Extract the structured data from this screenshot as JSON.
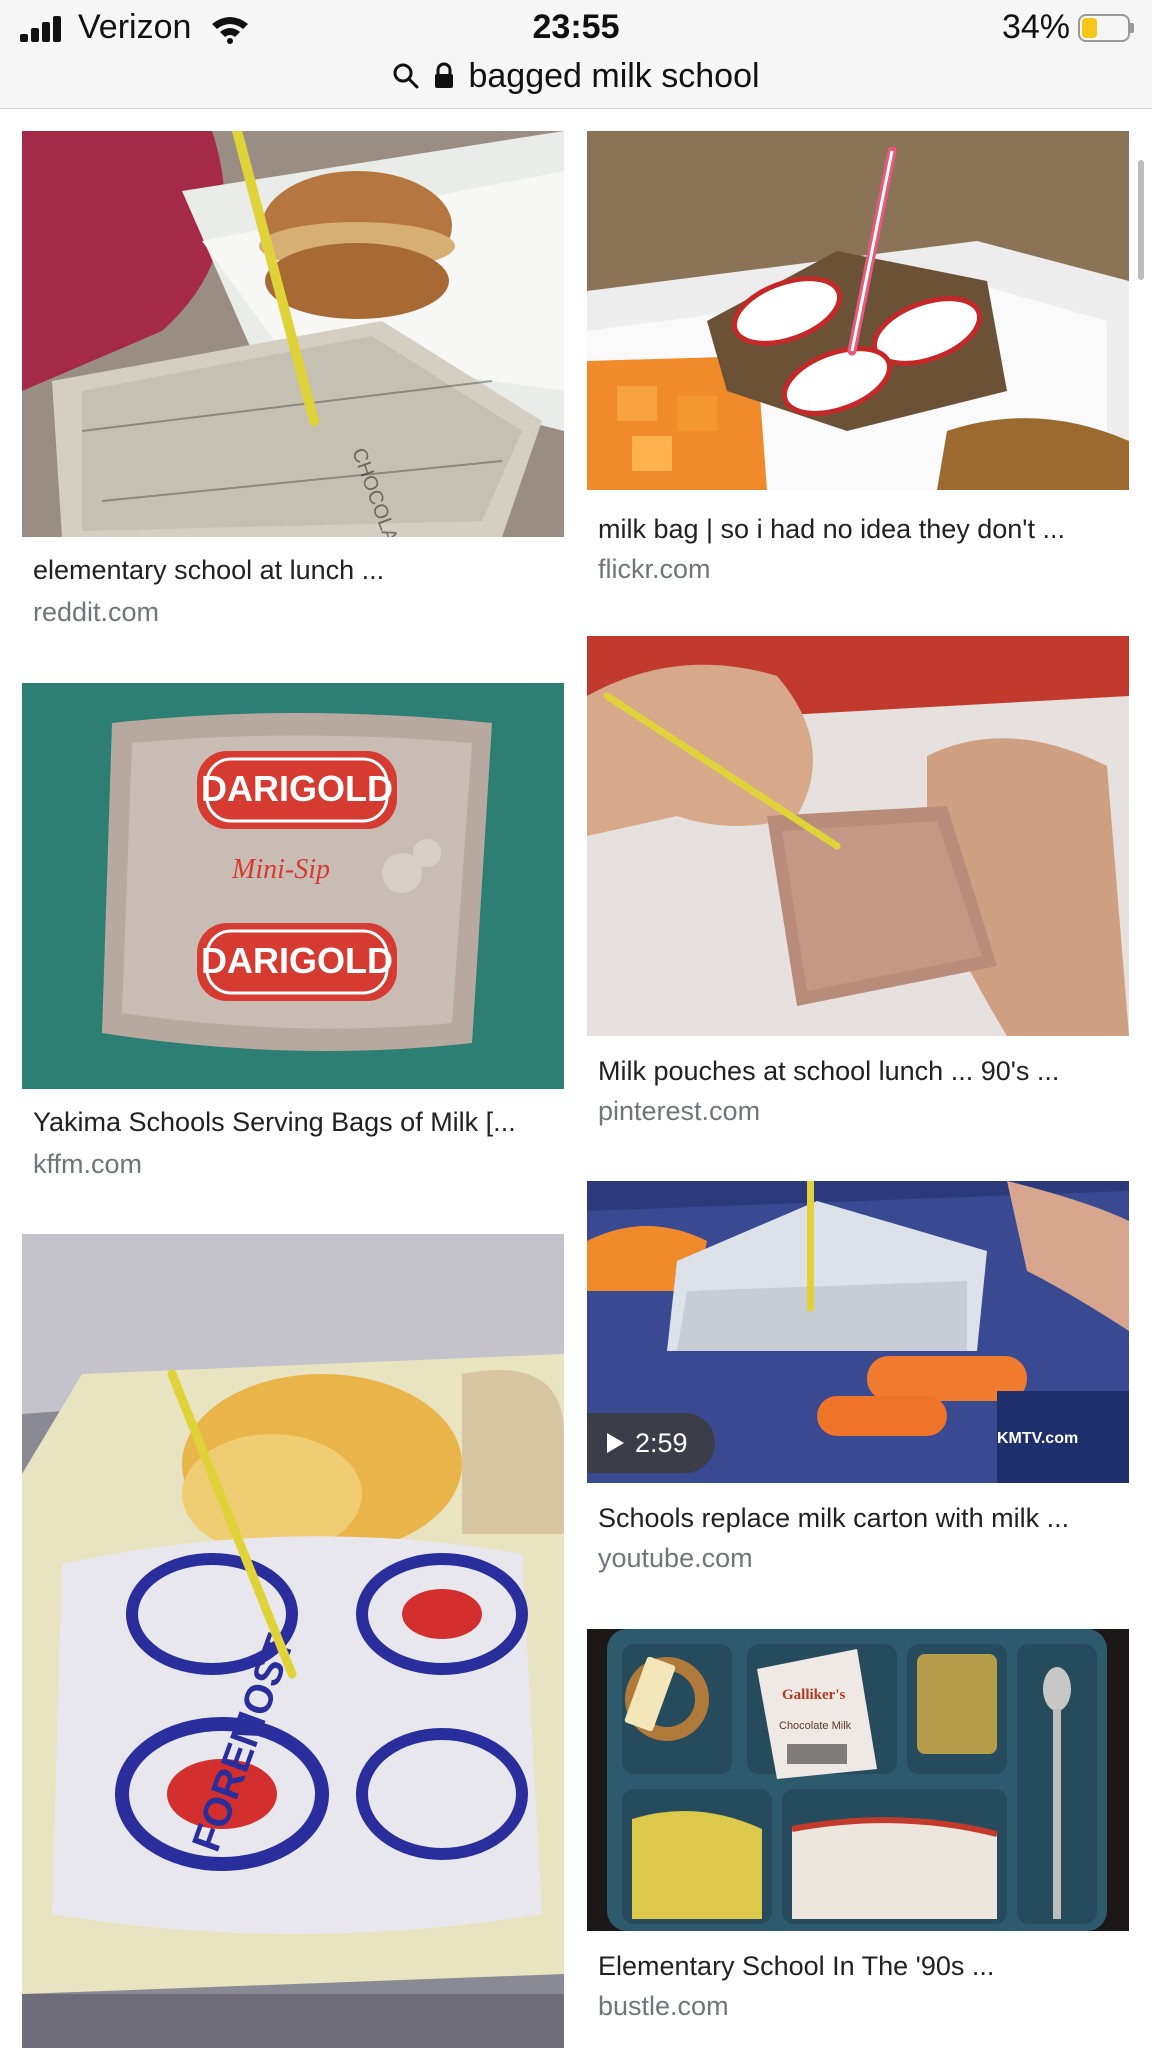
{
  "status_bar": {
    "carrier": "Verizon",
    "time": "23:55",
    "battery_percent_label": "34%",
    "battery_level": 0.34,
    "battery_color": "#f5c518"
  },
  "address_bar": {
    "query": "bagged milk school",
    "search_icon": "search-icon",
    "lock_icon": "lock-icon"
  },
  "results": [
    {
      "caption": "elementary school at lunch ...",
      "source": "reddit.com"
    },
    {
      "caption": "milk bag | so i had no idea they don't ...",
      "source": "flickr.com"
    },
    {
      "caption": "Milk pouches at school lunch ... 90's ...",
      "source": "pinterest.com"
    },
    {
      "caption": "Yakima Schools Serving Bags of Milk [...",
      "source": "kffm.com"
    },
    {
      "caption": "Schools replace milk carton with milk ...",
      "source": "youtube.com",
      "video_duration": "2:59"
    },
    {
      "caption": "Elementary School In The '90s ...",
      "source": "bustle.com"
    },
    {
      "caption": "",
      "source": ""
    }
  ],
  "image_text": {
    "darigold_brand": "DARIGOLD",
    "darigold_sub": "Mini-Sip",
    "foremost_brand": "FOREMOST",
    "kmtv": "KMTV.com",
    "carton_brand": "Galliker's",
    "carton_sub": "Chocolate Milk",
    "bag_print": "CHOCOLATE"
  }
}
